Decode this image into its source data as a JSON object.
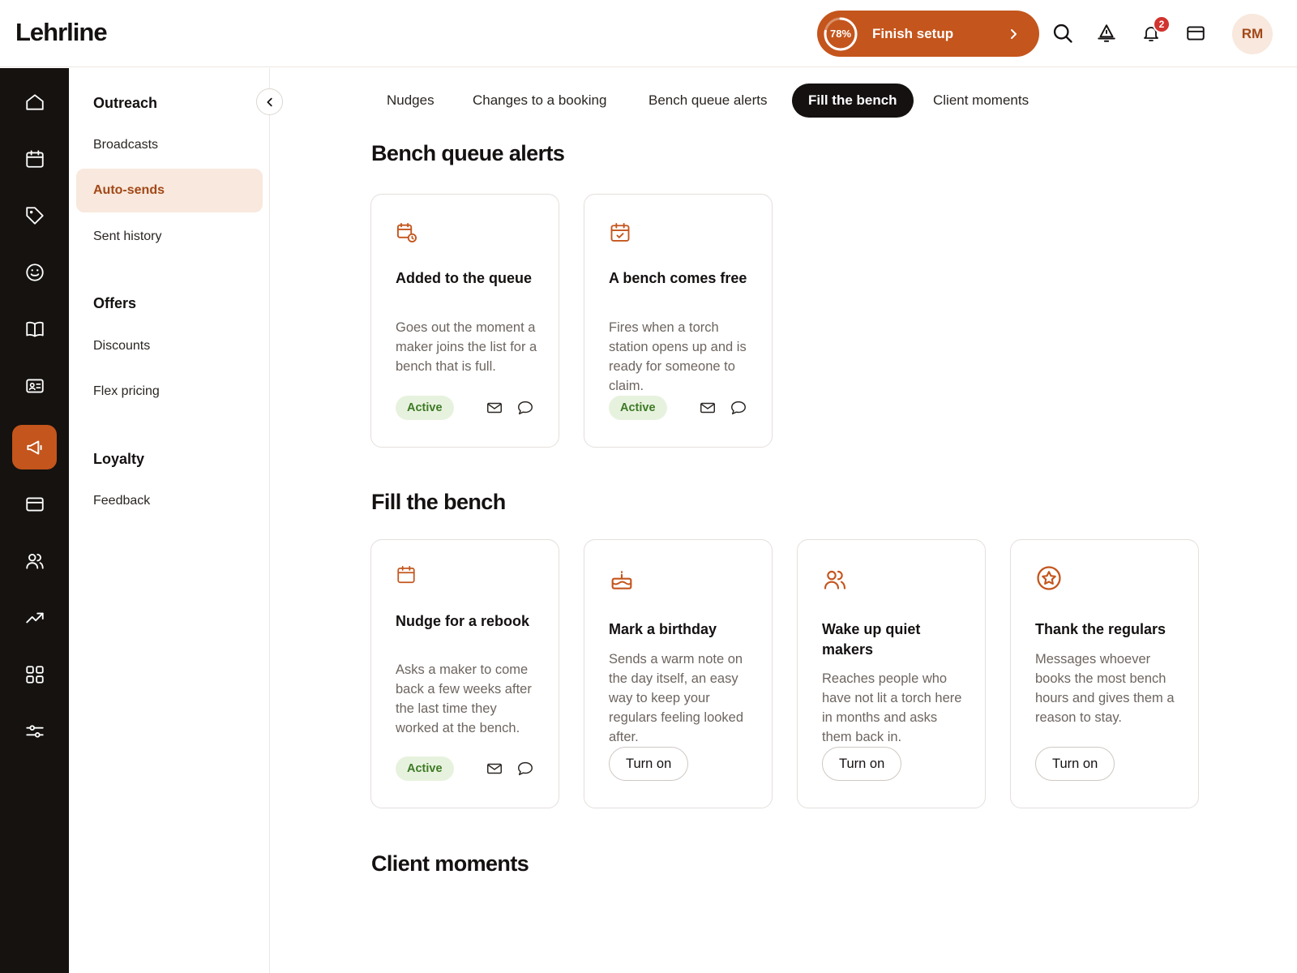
{
  "app": {
    "logo": "Lehrline"
  },
  "header": {
    "setup_progress": "78%",
    "setup_label": "Finish setup",
    "notification_count": "2",
    "avatar_initials": "RM"
  },
  "colors": {
    "accent": "#c4551c",
    "rail": "#151210",
    "active_bg": "#f8e8dd",
    "success": "#3d7a25"
  },
  "rail": {
    "icons": [
      "home-icon",
      "calendar-icon",
      "tag-icon",
      "smile-icon",
      "book-icon",
      "id-card-icon",
      "megaphone-icon",
      "card-icon",
      "users-icon",
      "trend-icon",
      "grid-icon",
      "sliders-icon"
    ],
    "active": "megaphone-icon"
  },
  "subnav": {
    "groups": [
      {
        "title": "Outreach",
        "items": [
          "Broadcasts",
          "Auto-sends",
          "Sent history"
        ]
      },
      {
        "title": "Offers",
        "items": [
          "Discounts",
          "Flex pricing"
        ]
      },
      {
        "title": "Loyalty",
        "items": [
          "Feedback"
        ]
      }
    ],
    "active_item": "Auto-sends"
  },
  "tabs": [
    {
      "label": "Nudges"
    },
    {
      "label": "Changes to a booking"
    },
    {
      "label": "Bench queue alerts"
    },
    {
      "label": "Fill the bench",
      "active": true
    },
    {
      "label": "Client moments"
    }
  ],
  "sections": [
    {
      "title": "Bench queue alerts",
      "cards": [
        {
          "icon": "calendar-clock-icon",
          "title": "Added to the queue",
          "desc": "Goes out the moment a maker joins the list for a bench that is full.",
          "status": "Active"
        },
        {
          "icon": "calendar-check-icon",
          "title": "A bench comes free",
          "desc": "Fires when a torch station opens up and is ready for someone to claim.",
          "status": "Active"
        }
      ]
    },
    {
      "title": "Fill the bench",
      "cards": [
        {
          "icon": "calendar-icon",
          "title": "Nudge for a rebook",
          "desc": "Asks a maker to come back a few weeks after the last time they worked at the bench.",
          "status": "Active"
        },
        {
          "icon": "cake-icon",
          "title": "Mark a birthday",
          "desc": "Sends a warm note on the day itself, an easy way to keep your regulars feeling looked after.",
          "action": "Turn on"
        },
        {
          "icon": "users-icon",
          "title": "Wake up quiet makers",
          "desc": "Reaches people who have not lit a torch here in months and asks them back in.",
          "action": "Turn on"
        },
        {
          "icon": "star-icon",
          "title": "Thank the regulars",
          "desc": "Messages whoever books the most bench hours and gives them a reason to stay.",
          "action": "Turn on"
        }
      ]
    },
    {
      "title": "Client moments",
      "cards": []
    }
  ]
}
